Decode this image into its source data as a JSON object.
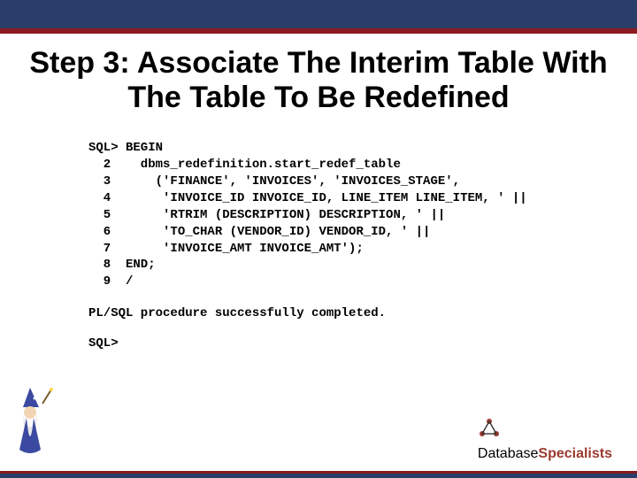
{
  "title": "Step 3: Associate The Interim Table With The Table To Be Redefined",
  "code": "SQL> BEGIN\n  2    dbms_redefinition.start_redef_table\n  3      ('FINANCE', 'INVOICES', 'INVOICES_STAGE',\n  4       'INVOICE_ID INVOICE_ID, LINE_ITEM LINE_ITEM, ' ||\n  5       'RTRIM (DESCRIPTION) DESCRIPTION, ' ||\n  6       'TO_CHAR (VENDOR_ID) VENDOR_ID, ' ||\n  7       'INVOICE_AMT INVOICE_AMT');\n  8  END;\n  9  /",
  "result": "PL/SQL procedure successfully completed.",
  "prompt": "SQL>",
  "logo": {
    "part1": "Database",
    "part2": "Specialists"
  }
}
